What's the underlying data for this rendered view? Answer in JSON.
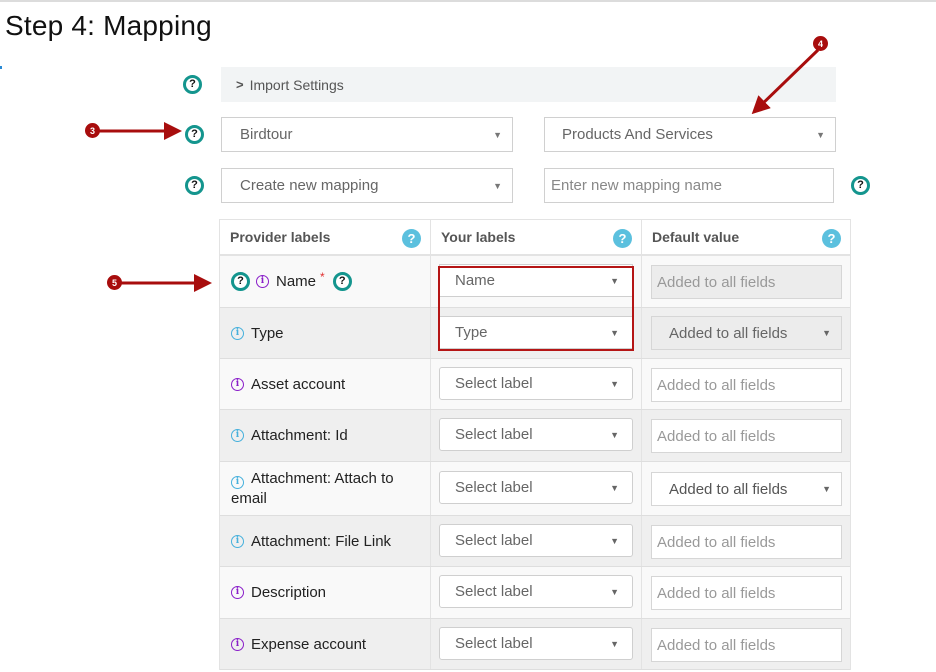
{
  "page": {
    "title": "Step 4: Mapping"
  },
  "import_settings": {
    "label": "Import Settings",
    "icon": "chevron-right-icon"
  },
  "form": {
    "provider_select": {
      "value": "Birdtour"
    },
    "entity_select": {
      "value": "Products And Services"
    },
    "mapping_select": {
      "value": "Create new mapping"
    },
    "mapping_name_input": {
      "value": "",
      "placeholder": "Enter new mapping name"
    }
  },
  "callouts": {
    "three": "3",
    "four": "4",
    "five": "5"
  },
  "help_icon_glyph": "?",
  "info_icon_glyph": "i",
  "caret_glyph": "▼",
  "table": {
    "headers": {
      "provider": "Provider labels",
      "yours": "Your labels",
      "default": "Default value"
    },
    "rows": [
      {
        "label": "Name",
        "required": "*",
        "info_color": "purple",
        "your_label": "Name",
        "default_placeholder": "Added to all fields",
        "default_type": "input",
        "default_disabled": true
      },
      {
        "label": "Type",
        "info_color": "blue",
        "your_label": "Type",
        "default_placeholder": "Added to all fields",
        "default_type": "select",
        "default_disabled": true
      },
      {
        "label": "Asset account",
        "info_color": "purple",
        "your_label": "Select label",
        "default_placeholder": "Added to all fields",
        "default_type": "input",
        "default_disabled": false
      },
      {
        "label": "Attachment: Id",
        "info_color": "blue",
        "your_label": "Select label",
        "default_placeholder": "Added to all fields",
        "default_type": "input",
        "default_disabled": false
      },
      {
        "label": "Attachment: Attach to email",
        "info_color": "blue",
        "your_label": "Select label",
        "default_placeholder": "Added to all fields",
        "default_type": "select",
        "default_disabled": false
      },
      {
        "label": "Attachment: File Link",
        "info_color": "blue",
        "your_label": "Select label",
        "default_placeholder": "Added to all fields",
        "default_type": "input",
        "default_disabled": false
      },
      {
        "label": "Description",
        "info_color": "purple",
        "your_label": "Select label",
        "default_placeholder": "Added to all fields",
        "default_type": "input",
        "default_disabled": false
      },
      {
        "label": "Expense account",
        "info_color": "purple",
        "your_label": "Select label",
        "default_placeholder": "Added to all fields",
        "default_type": "input",
        "default_disabled": false
      }
    ]
  },
  "colors": {
    "help_ring": "#14958e",
    "help_blue": "#5bc0de",
    "callout_red": "#a80d0d",
    "info_purple": "#8a1fc9",
    "info_blue": "#46b0dc",
    "required_red": "#e03030"
  }
}
